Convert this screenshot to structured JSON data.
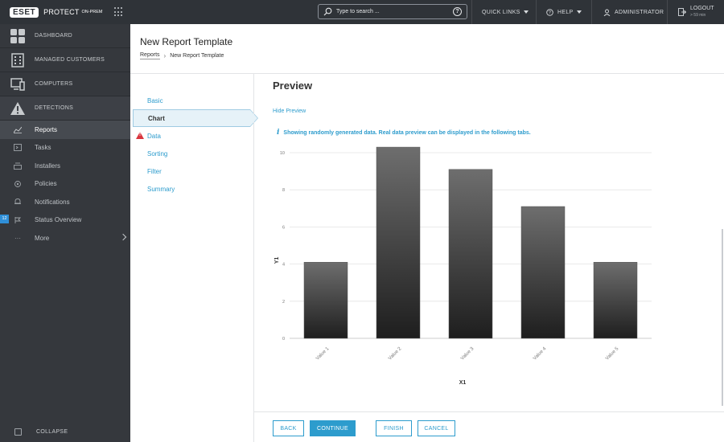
{
  "brand": {
    "logo": "ESET",
    "product": "PROTECT",
    "edition": "ON-PREM"
  },
  "topbar": {
    "search_placeholder": "Type to search ...",
    "quick_links": "QUICK LINKS",
    "help": "HELP",
    "user": "ADMINISTRATOR",
    "logout": "LOGOUT",
    "logout_time": "> 59 min"
  },
  "sidebar": {
    "main": [
      {
        "label": "DASHBOARD",
        "icon": "dashboard-icon"
      },
      {
        "label": "MANAGED CUSTOMERS",
        "icon": "building-icon"
      },
      {
        "label": "COMPUTERS",
        "icon": "computer-icon"
      },
      {
        "label": "DETECTIONS",
        "icon": "warning-icon"
      }
    ],
    "sub": [
      {
        "label": "Reports",
        "icon": "reports-icon",
        "active": true
      },
      {
        "label": "Tasks",
        "icon": "tasks-icon"
      },
      {
        "label": "Installers",
        "icon": "installers-icon"
      },
      {
        "label": "Policies",
        "icon": "policies-icon"
      },
      {
        "label": "Notifications",
        "icon": "notifications-icon"
      },
      {
        "label": "Status Overview",
        "icon": "status-icon",
        "badge": "12"
      },
      {
        "label": "More",
        "icon": "more-icon"
      }
    ],
    "collapse": "COLLAPSE"
  },
  "page": {
    "title": "New Report Template",
    "breadcrumb": [
      "Reports",
      "New Report Template"
    ]
  },
  "steps": [
    {
      "label": "Basic"
    },
    {
      "label": "Chart",
      "active": true
    },
    {
      "label": "Data",
      "warning": true
    },
    {
      "label": "Sorting"
    },
    {
      "label": "Filter"
    },
    {
      "label": "Summary"
    }
  ],
  "preview": {
    "title": "Preview",
    "hide_link": "Hide Preview",
    "info": "Showing randomly generated data. Real data preview can be displayed in the following tabs."
  },
  "chart_data": {
    "type": "bar",
    "categories": [
      "Value 1",
      "Value 2",
      "Value 3",
      "Value 4",
      "Value 5"
    ],
    "values": [
      4.1,
      10.3,
      9.1,
      7.1,
      4.1
    ],
    "xlabel": "X1",
    "ylabel": "Y1",
    "ylim": [
      0,
      10
    ],
    "yticks": [
      0,
      2,
      4,
      6,
      8,
      10
    ],
    "grid": true,
    "bar_color_top": "#6e6e6e",
    "bar_color_bottom": "#1e1e1e"
  },
  "footer": {
    "back": "BACK",
    "continue": "CONTINUE",
    "finish": "FINISH",
    "cancel": "CANCEL"
  },
  "colors": {
    "accent": "#2d9ccd",
    "topbar": "#2f3338",
    "sidebar": "#35383d",
    "warning": "#d9363e"
  }
}
